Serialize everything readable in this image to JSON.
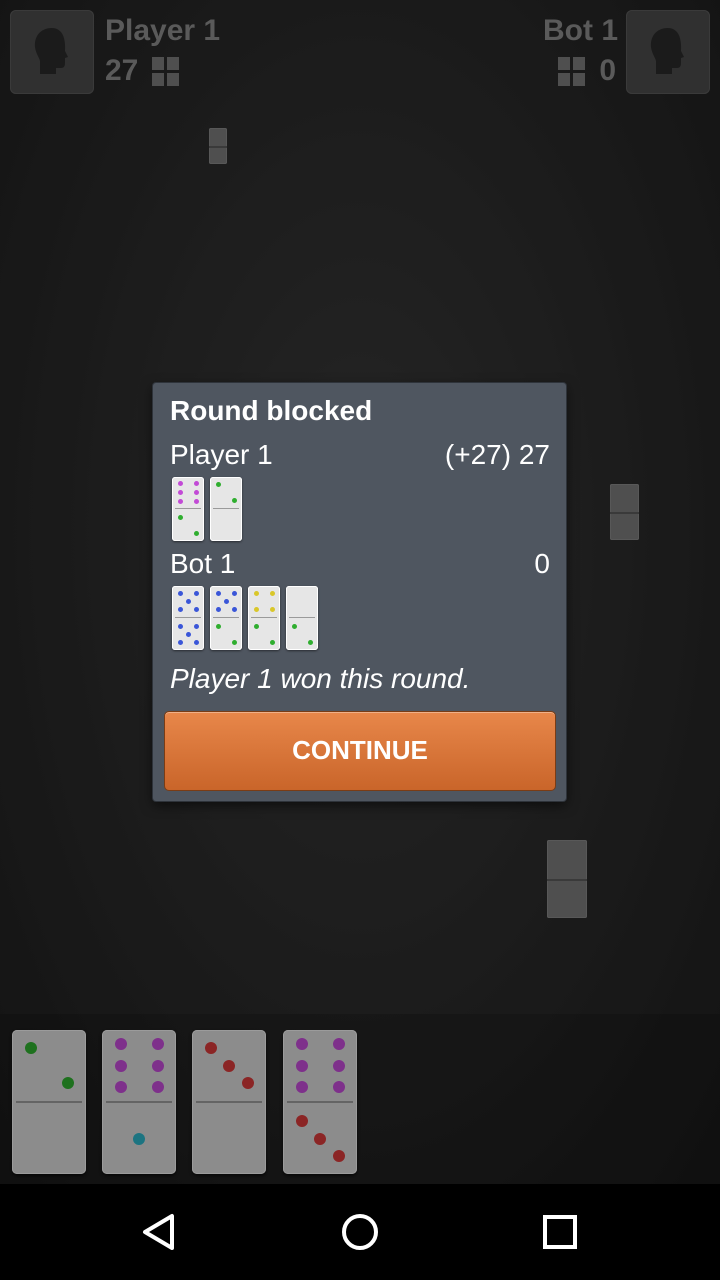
{
  "header": {
    "player1": {
      "name": "Player 1",
      "score": "27"
    },
    "bot1": {
      "name": "Bot 1",
      "score": "0"
    }
  },
  "dialog": {
    "title": "Round blocked",
    "rows": [
      {
        "name": "Player 1",
        "score": "(+27) 27",
        "tiles": [
          [
            6,
            2
          ],
          [
            2,
            0
          ]
        ]
      },
      {
        "name": "Bot 1",
        "score": "0",
        "tiles": [
          [
            5,
            5
          ],
          [
            5,
            2
          ],
          [
            4,
            2
          ],
          [
            0,
            2
          ]
        ]
      }
    ],
    "message": "Player 1 won this round.",
    "continue_label": "CONTINUE"
  },
  "hand": [
    [
      2,
      0
    ],
    [
      6,
      1
    ],
    [
      3,
      0
    ],
    [
      6,
      3
    ]
  ],
  "pip_colors": {
    "1": "#2bb3c7",
    "2": "#2fae2f",
    "3": "#d63a3a",
    "4": "#d9c72a",
    "5": "#3a56d8",
    "6": "#c24ad6"
  },
  "nav": {
    "back": "back-icon",
    "home": "home-icon",
    "recents": "recents-icon"
  }
}
